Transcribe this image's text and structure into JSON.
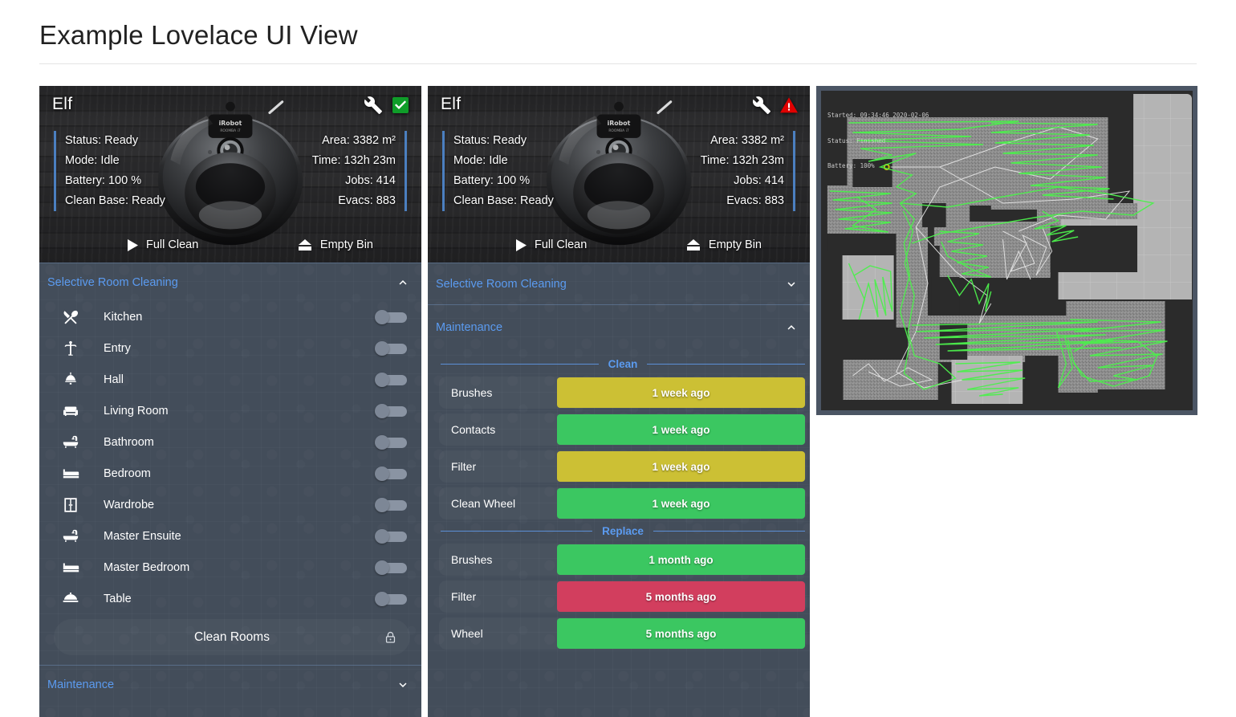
{
  "page": {
    "title": "Example Lovelace UI View"
  },
  "vacuum_cards": [
    {
      "name": "Elf",
      "status_icon": "check-square-icon",
      "status_icon_color": "#0f9d29",
      "wrench_icon": "wrench-icon",
      "stats_left": [
        "Status: Ready",
        "Mode: Idle",
        "Battery: 100 %",
        "Clean Base: Ready"
      ],
      "stats_right": [
        "Area: 3382 m²",
        "Time: 132h 23m",
        "Jobs: 414",
        "Evacs: 883"
      ],
      "actions": [
        {
          "label": "Full Clean",
          "icon": "play-icon"
        },
        {
          "label": "Empty Bin",
          "icon": "eject-bin-icon"
        }
      ]
    },
    {
      "name": "Elf",
      "status_icon": "alert-triangle-icon",
      "status_icon_color": "#e00000",
      "wrench_icon": "wrench-icon",
      "stats_left": [
        "Status: Ready",
        "Mode: Idle",
        "Battery: 100 %",
        "Clean Base: Ready"
      ],
      "stats_right": [
        "Area: 3382 m²",
        "Time: 132h 23m",
        "Jobs: 414",
        "Evacs: 883"
      ],
      "actions": [
        {
          "label": "Full Clean",
          "icon": "play-icon"
        },
        {
          "label": "Empty Bin",
          "icon": "eject-bin-icon"
        }
      ]
    }
  ],
  "left_column": {
    "selective_room_cleaning": {
      "title": "Selective Room Cleaning",
      "expanded": true,
      "chevron": "chevron-up-icon",
      "rooms": [
        {
          "label": "Kitchen",
          "icon": "silverware-icon",
          "on": false
        },
        {
          "label": "Entry",
          "icon": "coat-rack-icon",
          "on": false
        },
        {
          "label": "Hall",
          "icon": "ceiling-light-icon",
          "on": false
        },
        {
          "label": "Living Room",
          "icon": "sofa-icon",
          "on": false
        },
        {
          "label": "Bathroom",
          "icon": "bathtub-icon",
          "on": false
        },
        {
          "label": "Bedroom",
          "icon": "bed-icon",
          "on": false
        },
        {
          "label": "Wardrobe",
          "icon": "wardrobe-icon",
          "on": false
        },
        {
          "label": "Master Ensuite",
          "icon": "bathtub-icon",
          "on": false
        },
        {
          "label": "Master Bedroom",
          "icon": "bed-icon",
          "on": false
        },
        {
          "label": "Table",
          "icon": "food-cloche-icon",
          "on": false
        }
      ],
      "clean_rooms_button": {
        "label": "Clean Rooms",
        "lock_icon": "lock-icon"
      }
    },
    "maintenance": {
      "title": "Maintenance",
      "expanded": false,
      "chevron": "chevron-down-icon"
    }
  },
  "middle_column": {
    "selective_room_cleaning": {
      "title": "Selective Room Cleaning",
      "expanded": false,
      "chevron": "chevron-down-icon"
    },
    "maintenance": {
      "title": "Maintenance",
      "expanded": true,
      "chevron": "chevron-up-icon",
      "groups": [
        {
          "label": "Clean",
          "rows": [
            {
              "name": "Brushes",
              "value": "1 week ago",
              "color": "#ccc034"
            },
            {
              "name": "Contacts",
              "value": "1 week ago",
              "color": "#3bc761"
            },
            {
              "name": "Filter",
              "value": "1 week ago",
              "color": "#ccc034"
            },
            {
              "name": "Clean Wheel",
              "value": "1 week ago",
              "color": "#3bc761"
            }
          ]
        },
        {
          "label": "Replace",
          "rows": [
            {
              "name": "Brushes",
              "value": "1 month ago",
              "color": "#3bc761"
            },
            {
              "name": "Filter",
              "value": "5 months ago",
              "color": "#d23e5e"
            },
            {
              "name": "Wheel",
              "value": "5 months ago",
              "color": "#3bc761"
            }
          ]
        }
      ]
    }
  },
  "map_card": {
    "overlay_lines": [
      "Started: 09:34:46 2020-02-06",
      "Status: Finished",
      "Battery: 100%"
    ],
    "path_color": "#55ee55",
    "floor_color": "#8f8f8f",
    "background_color": "#2b2b2b"
  }
}
